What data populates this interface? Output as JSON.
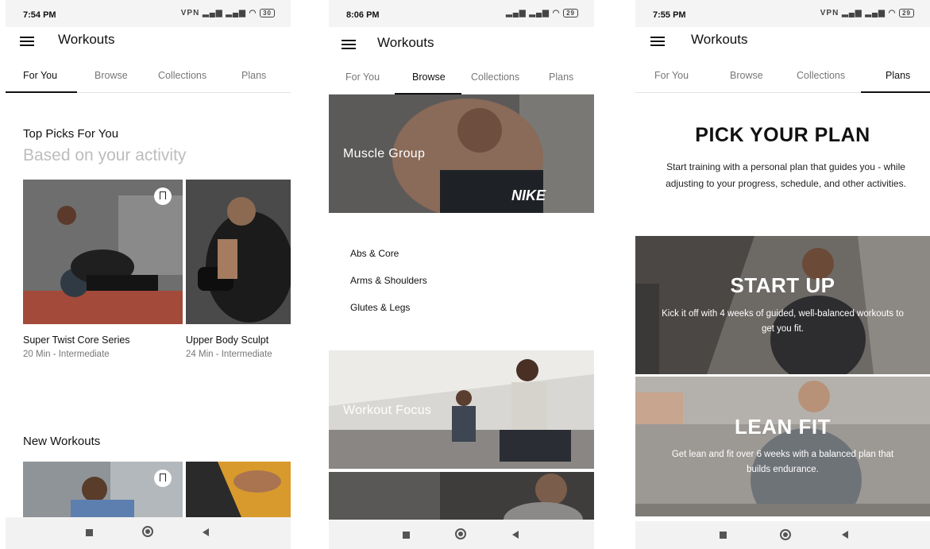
{
  "common": {
    "app_title": "Workouts",
    "tabs": [
      "For You",
      "Browse",
      "Collections",
      "Plans"
    ]
  },
  "screens": [
    {
      "time": "7:54 PM",
      "battery": "30",
      "active_tab": "For You",
      "top_picks": {
        "title": "Top Picks For You",
        "subtitle": "Based on your activity",
        "cards": [
          {
            "name": "Super Twist Core Series",
            "meta": "20 Min - Intermediate"
          },
          {
            "name": "Upper Body Sculpt",
            "meta": "24 Min - Intermediate"
          }
        ]
      },
      "new_workouts": {
        "title": "New Workouts"
      }
    },
    {
      "time": "8:06 PM",
      "battery": "29",
      "active_tab": "Browse",
      "muscle_group": {
        "label": "Muscle Group",
        "items": [
          "Abs & Core",
          "Arms & Shoulders",
          "Glutes & Legs"
        ]
      },
      "workout_focus": {
        "label": "Workout Focus"
      },
      "shirt_brand": "NIKE"
    },
    {
      "time": "7:55 PM",
      "battery": "29",
      "active_tab": "Plans",
      "heading": "PICK YOUR PLAN",
      "description": "Start training with a personal plan that guides you - while adjusting to your progress, schedule, and other activities.",
      "plans": [
        {
          "title": "START UP",
          "description": "Kick it off with 4 weeks of guided, well-balanced workouts to get you fit."
        },
        {
          "title": "LEAN FIT",
          "description": "Get lean and fit over 6 weeks with a balanced plan that builds endurance."
        }
      ]
    }
  ],
  "colors": {
    "accent": "#111111",
    "inactive_tab": "#777777",
    "subtitle_grey": "#bdbdbd"
  }
}
